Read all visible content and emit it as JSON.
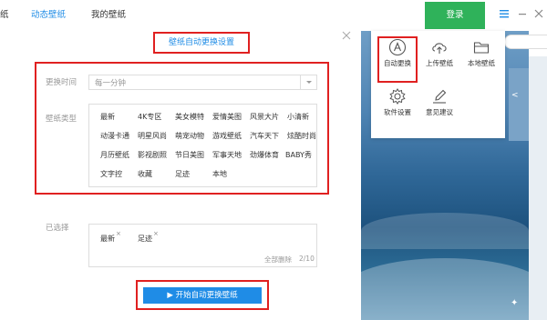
{
  "topbar": {
    "tabs": [
      {
        "label": "纸"
      },
      {
        "label": "动态壁纸"
      },
      {
        "label": "我的壁纸"
      }
    ],
    "login_label": "登录"
  },
  "dialog": {
    "title": "壁纸自动更换设置",
    "interval_label": "更换时间",
    "interval_value": "每一分钟",
    "category_label": "壁纸类型",
    "categories": [
      [
        "最新",
        "4K专区",
        "美女模特",
        "爱情美图",
        "风景大片",
        "小清新"
      ],
      [
        "动漫卡通",
        "明星风尚",
        "萌宠动物",
        "游戏壁纸",
        "汽车天下",
        "炫酷时尚"
      ],
      [
        "月历壁纸",
        "影视剧照",
        "节日美图",
        "军事天地",
        "劲爆体育",
        "BABY秀"
      ],
      [
        "文字控",
        "收藏",
        "足迹",
        "本地"
      ]
    ],
    "selected_label": "已选择",
    "selected": [
      "最新",
      "足迹"
    ],
    "chip_remove": "×",
    "clear_all": "全部删除",
    "count": "2/10",
    "start_button": "开始自动更换壁纸",
    "play_icon": "▶"
  },
  "menu": {
    "items": [
      {
        "label": "自动更换",
        "icon": "letter-a-circle-icon"
      },
      {
        "label": "上传壁纸",
        "icon": "cloud-upload-icon"
      },
      {
        "label": "本地壁纸",
        "icon": "folder-icon"
      },
      {
        "label": "软件设置",
        "icon": "gear-icon"
      },
      {
        "label": "意见建议",
        "icon": "edit-icon"
      }
    ]
  },
  "colors": {
    "accent": "#1f8ce6",
    "login": "#2fb25a",
    "highlight": "#e02020"
  }
}
